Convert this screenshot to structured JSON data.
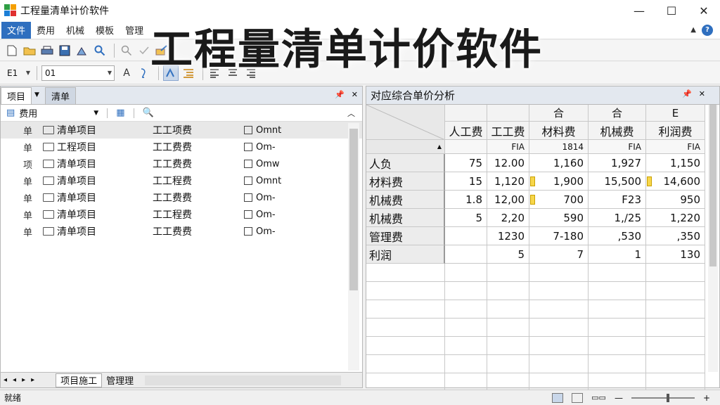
{
  "window": {
    "title": "工程量清单计价软件",
    "controls": {
      "minimize": "—",
      "maximize": "☐",
      "close": "✕"
    },
    "logo_colors": [
      "#2f9e44",
      "#f59f00",
      "#1c7ed6",
      "#e03131"
    ]
  },
  "overlay_title": "工程量清单计价软件",
  "menu": {
    "items": [
      "文件",
      "费用",
      "机械",
      "模板",
      "管理"
    ],
    "active_index": 0,
    "help": "?"
  },
  "toolbar1": {
    "icons": [
      "new-file-icon",
      "open-folder-icon",
      "print-icon",
      "save-icon",
      "preview-icon",
      "search-icon",
      "zoom-icon",
      "check-icon",
      "edit-icon"
    ]
  },
  "toolbar2": {
    "style_value": "E1",
    "font_value": "01",
    "icons": [
      "font-icon",
      "format-icon",
      "highlight-icon",
      "indent-icon",
      "align-left-icon",
      "align-center-icon",
      "align-right-icon"
    ]
  },
  "left_panel": {
    "tabs": [
      "项目",
      "清单"
    ],
    "filter_label": "费用",
    "rows": [
      {
        "code": "单",
        "name": "清单项目",
        "fee": "工工项费",
        "extra": "Omnt"
      },
      {
        "code": "单",
        "name": "工程项目",
        "fee": "工工费费",
        "extra": "Om-"
      },
      {
        "code": "项",
        "name": "清单项目",
        "fee": "工工费费",
        "extra": "Omw"
      },
      {
        "code": "单",
        "name": "清单项目",
        "fee": "工工程费",
        "extra": "Omnt"
      },
      {
        "code": "单",
        "name": "清单项目",
        "fee": "工工费费",
        "extra": "Om-"
      },
      {
        "code": "单",
        "name": "清单项目",
        "fee": "工工程费",
        "extra": "Om-"
      },
      {
        "code": "单",
        "name": "清单项目",
        "fee": "工工费费",
        "extra": "Om-"
      }
    ],
    "bottom_tabs": [
      "项目施工",
      "管理理"
    ]
  },
  "right_panel": {
    "title": "对应综合单价分析",
    "group_headers": [
      "",
      "",
      "合",
      "合",
      "E"
    ],
    "column_headers": [
      "人工费",
      "工工费",
      "材料费",
      "机械费",
      "利润费"
    ],
    "unit_row": [
      "",
      "FIA",
      "1814",
      "FIA",
      "FIA"
    ],
    "rows": [
      {
        "label": "人负",
        "values": [
          "75",
          "12.00",
          "1,160",
          "1,927",
          "1,150"
        ]
      },
      {
        "label": "材料费",
        "values": [
          "15",
          "1,120",
          "1,900",
          "15,500",
          "14,600"
        ]
      },
      {
        "label": "机械费",
        "values": [
          "1.8",
          "12,00",
          "700",
          "F23",
          "950"
        ]
      },
      {
        "label": "机械费",
        "values": [
          "5",
          "2,20",
          "590",
          "1,/25",
          "1,220"
        ]
      },
      {
        "label": "管理费",
        "values": [
          "",
          "1230",
          "7-180",
          ",530",
          ",350"
        ]
      },
      {
        "label": "利润",
        "values": [
          "",
          "5",
          "7",
          "1",
          "130"
        ]
      }
    ]
  },
  "statusbar": {
    "text": "就绪"
  }
}
